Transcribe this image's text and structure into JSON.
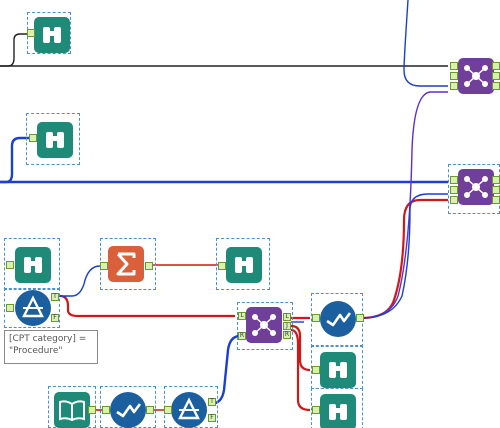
{
  "canvas": {
    "colors": {
      "browse": "#1f8a78",
      "summarize": "#d9603a",
      "union": "#6f3f9a",
      "sample": "#1b5f9e",
      "input": "#1f8a78",
      "filter": "#1b5f9e",
      "wire_black": "#222222",
      "wire_blue": "#1a3fd1",
      "wire_red": "#d01818"
    },
    "tools": [
      {
        "name": "browse-tool-1",
        "icon": "binoculars-icon"
      },
      {
        "name": "browse-tool-2",
        "icon": "binoculars-icon"
      },
      {
        "name": "browse-tool-3",
        "icon": "binoculars-icon"
      },
      {
        "name": "filter-tool-1",
        "icon": "filter-triangle-icon"
      },
      {
        "name": "summarize-tool",
        "icon": "sigma-icon"
      },
      {
        "name": "browse-tool-4",
        "icon": "binoculars-icon"
      },
      {
        "name": "union-tool-1",
        "icon": "union-icon"
      },
      {
        "name": "union-tool-2",
        "icon": "union-icon"
      },
      {
        "name": "union-tool-3",
        "icon": "union-icon"
      },
      {
        "name": "sample-tool-1",
        "icon": "checkmark-wave-icon"
      },
      {
        "name": "browse-tool-5",
        "icon": "binoculars-icon"
      },
      {
        "name": "browse-tool-6",
        "icon": "binoculars-icon"
      },
      {
        "name": "input-tool",
        "icon": "book-icon"
      },
      {
        "name": "sample-tool-2",
        "icon": "checkmark-wave-icon"
      },
      {
        "name": "filter-tool-2",
        "icon": "filter-triangle-icon"
      }
    ],
    "annotation": "[CPT category] =\n\"Procedure\"",
    "anchor_labels": {
      "true": "T",
      "false": "F",
      "left": "L",
      "join": "J",
      "right": "R",
      "input": "I"
    }
  }
}
